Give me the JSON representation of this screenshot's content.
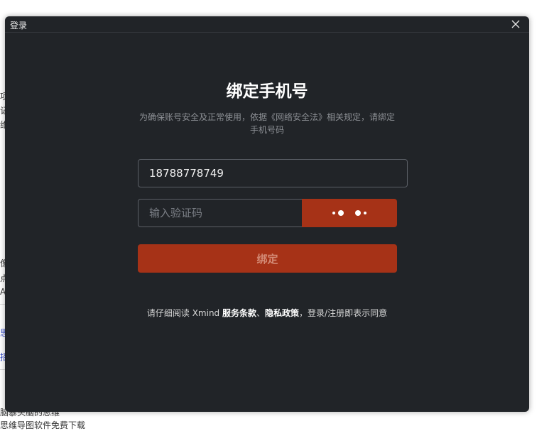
{
  "background": {
    "fragments": [
      {
        "text": "项",
        "kind": "text"
      },
      {
        "text": "记",
        "kind": "text"
      },
      {
        "text": "维",
        "kind": "text"
      },
      {
        "text": "像",
        "kind": "text"
      },
      {
        "text": "点",
        "kind": "text"
      },
      {
        "text": "A",
        "kind": "text"
      },
      {
        "text": "思",
        "kind": "link"
      },
      {
        "text": "招",
        "kind": "link"
      },
      {
        "text": "脑暴头脑的思维",
        "kind": "text"
      },
      {
        "text": "思维导图软件免费下载",
        "kind": "text"
      }
    ]
  },
  "dialog": {
    "window_title": "登录",
    "heading": "绑定手机号",
    "description": "为确保账号安全及正常使用，依据《网络安全法》相关规定，请绑定手机号码",
    "phone": {
      "value": "18788778749"
    },
    "code": {
      "placeholder": "输入验证码",
      "value": ""
    },
    "send_code_state": "loading",
    "bind_button": "绑定",
    "terms": {
      "prefix": "请仔细阅读 Xmind ",
      "service_terms": "服务条款",
      "separator": "、",
      "privacy_policy": "隐私政策",
      "suffix": "，登录/注册即表示同意"
    }
  },
  "colors": {
    "dialog_bg": "#212428",
    "accent": "#a63217",
    "input_border": "#5b5f66"
  },
  "icons": {
    "close": "close-icon",
    "loading": "loading-dots-icon"
  }
}
